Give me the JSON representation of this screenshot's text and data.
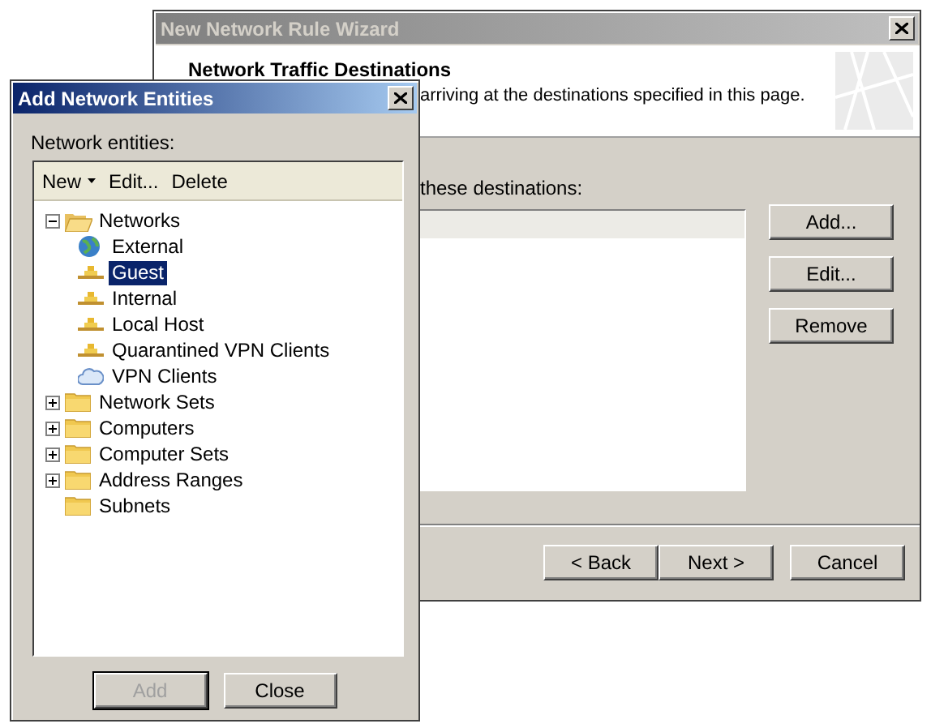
{
  "wizard": {
    "title": "New Network Rule Wizard",
    "heading": "Network Traffic Destinations",
    "description": "arriving at the destinations specified in this page.",
    "list_label": "these destinations:",
    "side_buttons": [
      "Add...",
      "Edit...",
      "Remove"
    ],
    "nav_buttons": [
      "< Back",
      "Next >",
      "Cancel"
    ]
  },
  "dialog": {
    "title": "Add Network Entities",
    "label": "Network entities:",
    "toolbar": [
      {
        "label": "New",
        "kind": "menu"
      },
      {
        "label": "Edit...",
        "kind": "plain"
      },
      {
        "label": "Delete",
        "kind": "plain"
      }
    ],
    "tree": [
      {
        "label": "Networks",
        "kind": "folder",
        "expanded": true,
        "selected": false,
        "children": [
          {
            "label": "External",
            "kind": "globe",
            "selected": false
          },
          {
            "label": "Guest",
            "kind": "network",
            "selected": true
          },
          {
            "label": "Internal",
            "kind": "network",
            "selected": false
          },
          {
            "label": "Local Host",
            "kind": "network",
            "selected": false
          },
          {
            "label": "Quarantined VPN Clients",
            "kind": "network",
            "selected": false
          },
          {
            "label": "VPN Clients",
            "kind": "vpn",
            "selected": false
          }
        ]
      },
      {
        "label": "Network Sets",
        "kind": "folder",
        "expanded": false,
        "selected": false
      },
      {
        "label": "Computers",
        "kind": "folder",
        "expanded": false,
        "selected": false
      },
      {
        "label": "Computer Sets",
        "kind": "folder",
        "expanded": false,
        "selected": false
      },
      {
        "label": "Address Ranges",
        "kind": "folder",
        "expanded": false,
        "selected": false
      },
      {
        "label": "Subnets",
        "kind": "folder",
        "selected": false
      }
    ],
    "buttons": [
      {
        "label": "Add",
        "disabled": true
      },
      {
        "label": "Close",
        "disabled": false
      }
    ]
  }
}
